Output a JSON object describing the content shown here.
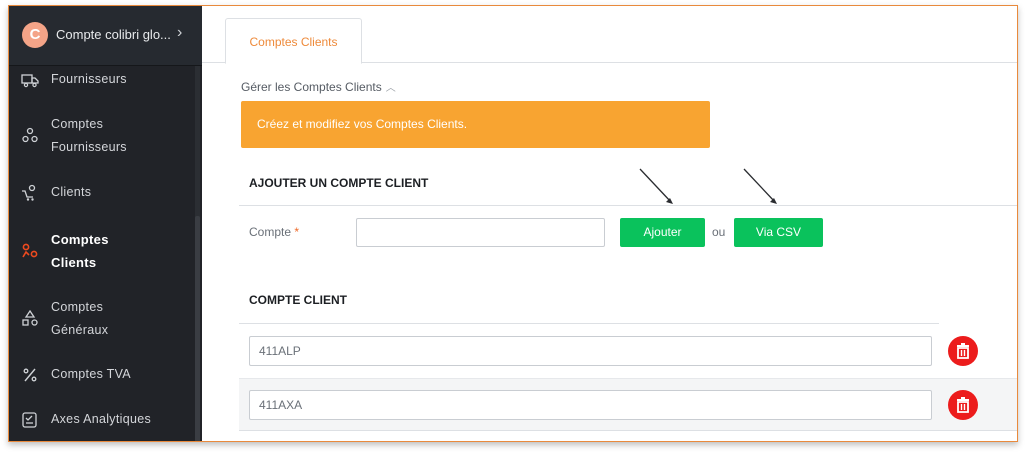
{
  "sidebar": {
    "account_initial": "C",
    "account_title": "Compte colibri glo...",
    "items": [
      {
        "label": "Fournisseurs",
        "icon": "truck-icon"
      },
      {
        "label": "Comptes",
        "label2": "Fournisseurs",
        "icon": "supplier-accounts-icon"
      },
      {
        "label": "Clients",
        "icon": "clients-icon"
      },
      {
        "label": "Comptes",
        "label2": "Clients",
        "icon": "client-accounts-icon"
      },
      {
        "label": "Comptes",
        "label2": "Généraux",
        "icon": "general-accounts-icon"
      },
      {
        "label": "Comptes TVA",
        "icon": "percent-icon"
      },
      {
        "label": "Axes Analytiques",
        "icon": "checklist-icon"
      }
    ]
  },
  "tabs": [
    {
      "label": "Comptes Clients"
    }
  ],
  "section": {
    "toggle_label": "Gérer les Comptes Clients",
    "banner": "Créez et modifiez vos Comptes Clients."
  },
  "add": {
    "heading": "AJOUTER UN COMPTE CLIENT",
    "field_label": "Compte",
    "required_mark": "*",
    "input_value": "",
    "add_button": "Ajouter",
    "or_text": "ou",
    "csv_button": "Via CSV"
  },
  "list": {
    "heading": "COMPTE CLIENT",
    "rows": [
      {
        "value": "411ALP"
      },
      {
        "value": "411AXA"
      }
    ]
  },
  "colors": {
    "accent": "#f8a431",
    "success": "#0ac25c",
    "danger": "#ec1c1c",
    "sidebar_bg": "#212328",
    "active_icon": "#ee4a1f"
  }
}
